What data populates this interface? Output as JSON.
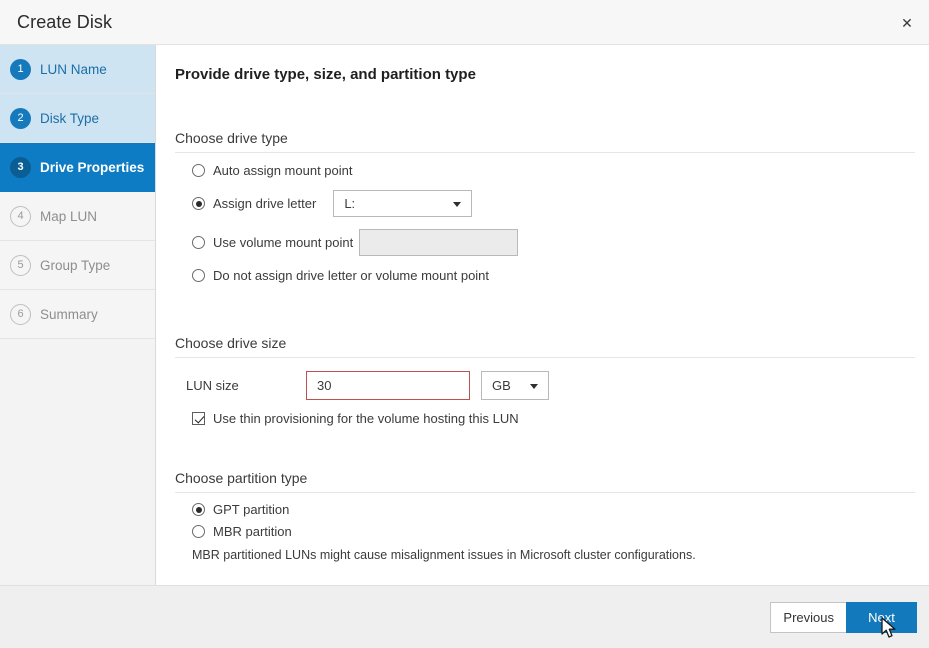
{
  "window": {
    "title": "Create Disk",
    "close_label": "✕"
  },
  "sidebar": {
    "steps": [
      {
        "num": "1",
        "label": "LUN Name",
        "state": "done"
      },
      {
        "num": "2",
        "label": "Disk Type",
        "state": "done"
      },
      {
        "num": "3",
        "label": "Drive Properties",
        "state": "active"
      },
      {
        "num": "4",
        "label": "Map LUN",
        "state": "pending"
      },
      {
        "num": "5",
        "label": "Group Type",
        "state": "pending"
      },
      {
        "num": "6",
        "label": "Summary",
        "state": "pending"
      }
    ]
  },
  "main": {
    "page_title": "Provide drive type, size, and partition type",
    "drive_type": {
      "section_title": "Choose drive type",
      "option_auto": "Auto assign mount point",
      "option_letter": "Assign drive letter",
      "drive_letter_value": "L:",
      "option_volume_mount": "Use volume mount point",
      "volume_mount_value": "",
      "option_none": "Do not assign drive letter or volume mount point"
    },
    "drive_size": {
      "section_title": "Choose drive size",
      "lun_size_label": "LUN size",
      "lun_size_value": "30",
      "lun_size_placeholder": "",
      "unit_value": "GB",
      "thin_provisioning_label": "Use thin provisioning for the volume hosting this LUN"
    },
    "partition_type": {
      "section_title": "Choose partition type",
      "option_gpt": "GPT partition",
      "option_mbr": "MBR partition",
      "note": "MBR partitioned LUNs might cause misalignment issues in Microsoft cluster configurations."
    }
  },
  "footer": {
    "previous_label": "Previous",
    "next_label": "Next"
  },
  "colors": {
    "accent": "#1279bd",
    "active_step": "#0d7cc4",
    "done_step_bg": "#cfe4f2",
    "error_border": "#c0504d"
  }
}
